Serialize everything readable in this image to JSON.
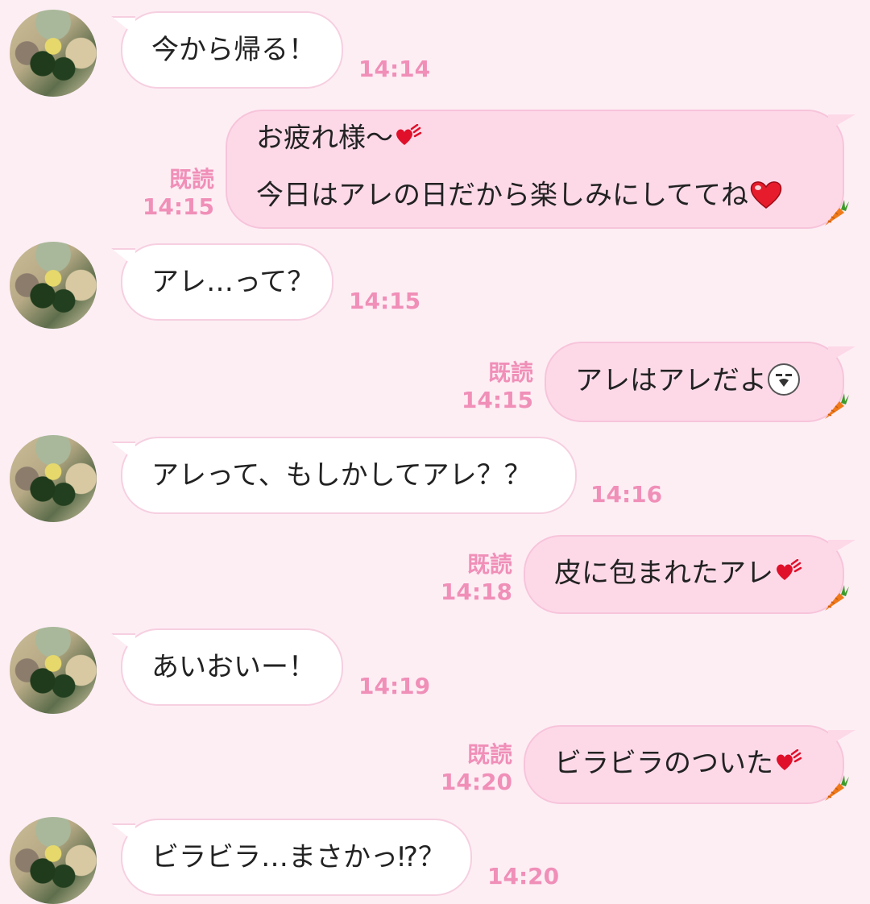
{
  "colors": {
    "background": "#fdeef4",
    "incoming_bubble": "#ffffff",
    "outgoing_bubble": "#fdd9e8",
    "timestamp": "#f08fb8"
  },
  "messages": [
    {
      "direction": "in",
      "text": "今から帰る！",
      "time": "14:14"
    },
    {
      "direction": "out",
      "lines": [
        "お疲れ様〜",
        "今日はアレの日だから楽しみにしててね"
      ],
      "emojis": [
        "heart-swoosh-icon",
        "red-heart-icon"
      ],
      "read": "既読",
      "time": "14:15",
      "reaction": "carrot-icon"
    },
    {
      "direction": "in",
      "text": "アレ…って？",
      "time": "14:15"
    },
    {
      "direction": "out",
      "lines": [
        "アレはアレだよ"
      ],
      "emojis": [
        "smirk-face-icon"
      ],
      "read": "既読",
      "time": "14:15",
      "reaction": "carrot-icon"
    },
    {
      "direction": "in",
      "text": "アレって、もしかしてアレ？？",
      "time": "14:16"
    },
    {
      "direction": "out",
      "lines": [
        "皮に包まれたアレ"
      ],
      "emojis": [
        "heart-swoosh-icon"
      ],
      "read": "既読",
      "time": "14:18",
      "reaction": "carrot-icon"
    },
    {
      "direction": "in",
      "text": "あいおいー！",
      "time": "14:19"
    },
    {
      "direction": "out",
      "lines": [
        "ビラビラのついた"
      ],
      "emojis": [
        "heart-swoosh-icon"
      ],
      "read": "既読",
      "time": "14:20",
      "reaction": "carrot-icon"
    },
    {
      "direction": "in",
      "text": "ビラビラ…まさかっ⁉？",
      "time": "14:20"
    }
  ]
}
